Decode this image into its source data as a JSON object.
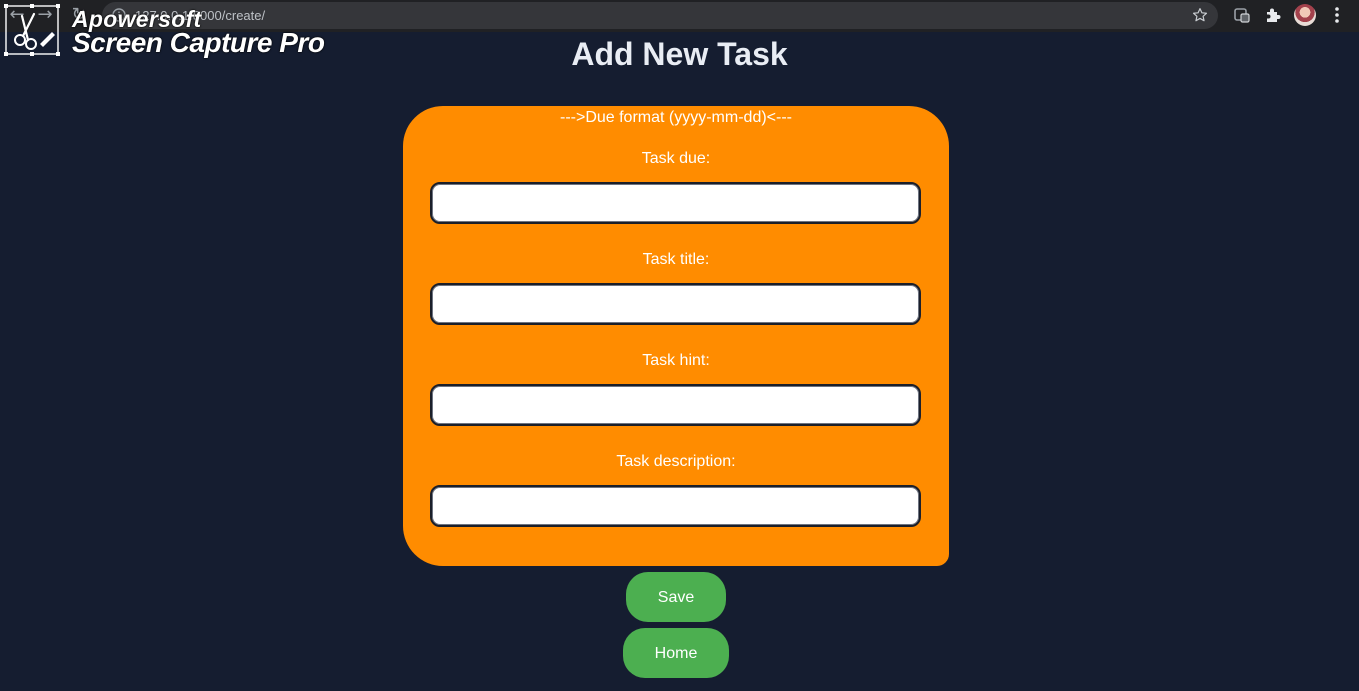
{
  "browser": {
    "url": "127.0.0.1:8000/create/",
    "icons": {
      "back": "arrow-left-icon",
      "forward": "arrow-right-icon",
      "reload": "reload-icon",
      "site_info": "info-circle-icon",
      "bookmark": "star-icon",
      "extension_1": "extension-badge-icon",
      "extensions": "puzzle-icon",
      "profile": "avatar",
      "menu": "kebab-menu-icon"
    }
  },
  "watermark": {
    "line1": "Apowersoft",
    "line2": "Screen Capture Pro"
  },
  "page": {
    "title": "Add New Task"
  },
  "form": {
    "hint": "--->Due format (yyyy-mm-dd)<---",
    "fields": [
      {
        "label": "Task due:",
        "value": "",
        "placeholder": ""
      },
      {
        "label": "Task title:",
        "value": "",
        "placeholder": ""
      },
      {
        "label": "Task hint:",
        "value": "",
        "placeholder": ""
      },
      {
        "label": "Task description:",
        "value": "",
        "placeholder": ""
      }
    ]
  },
  "buttons": {
    "save": "Save",
    "home": "Home"
  },
  "colors": {
    "background": "#151d30",
    "card": "#ff8c00",
    "button": "#4caf50",
    "title": "#e9edf4"
  }
}
